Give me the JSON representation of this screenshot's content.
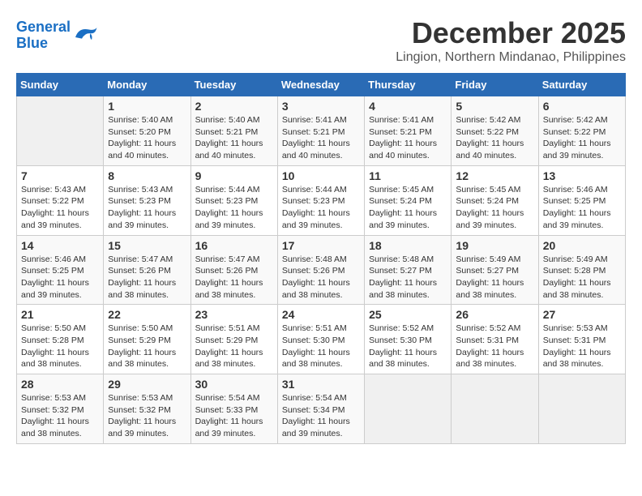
{
  "logo": {
    "line1": "General",
    "line2": "Blue"
  },
  "title": "December 2025",
  "location": "Lingion, Northern Mindanao, Philippines",
  "days_of_week": [
    "Sunday",
    "Monday",
    "Tuesday",
    "Wednesday",
    "Thursday",
    "Friday",
    "Saturday"
  ],
  "weeks": [
    [
      {
        "day": "",
        "info": ""
      },
      {
        "day": "1",
        "info": "Sunrise: 5:40 AM\nSunset: 5:20 PM\nDaylight: 11 hours\nand 40 minutes."
      },
      {
        "day": "2",
        "info": "Sunrise: 5:40 AM\nSunset: 5:21 PM\nDaylight: 11 hours\nand 40 minutes."
      },
      {
        "day": "3",
        "info": "Sunrise: 5:41 AM\nSunset: 5:21 PM\nDaylight: 11 hours\nand 40 minutes."
      },
      {
        "day": "4",
        "info": "Sunrise: 5:41 AM\nSunset: 5:21 PM\nDaylight: 11 hours\nand 40 minutes."
      },
      {
        "day": "5",
        "info": "Sunrise: 5:42 AM\nSunset: 5:22 PM\nDaylight: 11 hours\nand 40 minutes."
      },
      {
        "day": "6",
        "info": "Sunrise: 5:42 AM\nSunset: 5:22 PM\nDaylight: 11 hours\nand 39 minutes."
      }
    ],
    [
      {
        "day": "7",
        "info": "Sunrise: 5:43 AM\nSunset: 5:22 PM\nDaylight: 11 hours\nand 39 minutes."
      },
      {
        "day": "8",
        "info": "Sunrise: 5:43 AM\nSunset: 5:23 PM\nDaylight: 11 hours\nand 39 minutes."
      },
      {
        "day": "9",
        "info": "Sunrise: 5:44 AM\nSunset: 5:23 PM\nDaylight: 11 hours\nand 39 minutes."
      },
      {
        "day": "10",
        "info": "Sunrise: 5:44 AM\nSunset: 5:23 PM\nDaylight: 11 hours\nand 39 minutes."
      },
      {
        "day": "11",
        "info": "Sunrise: 5:45 AM\nSunset: 5:24 PM\nDaylight: 11 hours\nand 39 minutes."
      },
      {
        "day": "12",
        "info": "Sunrise: 5:45 AM\nSunset: 5:24 PM\nDaylight: 11 hours\nand 39 minutes."
      },
      {
        "day": "13",
        "info": "Sunrise: 5:46 AM\nSunset: 5:25 PM\nDaylight: 11 hours\nand 39 minutes."
      }
    ],
    [
      {
        "day": "14",
        "info": "Sunrise: 5:46 AM\nSunset: 5:25 PM\nDaylight: 11 hours\nand 39 minutes."
      },
      {
        "day": "15",
        "info": "Sunrise: 5:47 AM\nSunset: 5:26 PM\nDaylight: 11 hours\nand 38 minutes."
      },
      {
        "day": "16",
        "info": "Sunrise: 5:47 AM\nSunset: 5:26 PM\nDaylight: 11 hours\nand 38 minutes."
      },
      {
        "day": "17",
        "info": "Sunrise: 5:48 AM\nSunset: 5:26 PM\nDaylight: 11 hours\nand 38 minutes."
      },
      {
        "day": "18",
        "info": "Sunrise: 5:48 AM\nSunset: 5:27 PM\nDaylight: 11 hours\nand 38 minutes."
      },
      {
        "day": "19",
        "info": "Sunrise: 5:49 AM\nSunset: 5:27 PM\nDaylight: 11 hours\nand 38 minutes."
      },
      {
        "day": "20",
        "info": "Sunrise: 5:49 AM\nSunset: 5:28 PM\nDaylight: 11 hours\nand 38 minutes."
      }
    ],
    [
      {
        "day": "21",
        "info": "Sunrise: 5:50 AM\nSunset: 5:28 PM\nDaylight: 11 hours\nand 38 minutes."
      },
      {
        "day": "22",
        "info": "Sunrise: 5:50 AM\nSunset: 5:29 PM\nDaylight: 11 hours\nand 38 minutes."
      },
      {
        "day": "23",
        "info": "Sunrise: 5:51 AM\nSunset: 5:29 PM\nDaylight: 11 hours\nand 38 minutes."
      },
      {
        "day": "24",
        "info": "Sunrise: 5:51 AM\nSunset: 5:30 PM\nDaylight: 11 hours\nand 38 minutes."
      },
      {
        "day": "25",
        "info": "Sunrise: 5:52 AM\nSunset: 5:30 PM\nDaylight: 11 hours\nand 38 minutes."
      },
      {
        "day": "26",
        "info": "Sunrise: 5:52 AM\nSunset: 5:31 PM\nDaylight: 11 hours\nand 38 minutes."
      },
      {
        "day": "27",
        "info": "Sunrise: 5:53 AM\nSunset: 5:31 PM\nDaylight: 11 hours\nand 38 minutes."
      }
    ],
    [
      {
        "day": "28",
        "info": "Sunrise: 5:53 AM\nSunset: 5:32 PM\nDaylight: 11 hours\nand 38 minutes."
      },
      {
        "day": "29",
        "info": "Sunrise: 5:53 AM\nSunset: 5:32 PM\nDaylight: 11 hours\nand 39 minutes."
      },
      {
        "day": "30",
        "info": "Sunrise: 5:54 AM\nSunset: 5:33 PM\nDaylight: 11 hours\nand 39 minutes."
      },
      {
        "day": "31",
        "info": "Sunrise: 5:54 AM\nSunset: 5:34 PM\nDaylight: 11 hours\nand 39 minutes."
      },
      {
        "day": "",
        "info": ""
      },
      {
        "day": "",
        "info": ""
      },
      {
        "day": "",
        "info": ""
      }
    ]
  ]
}
